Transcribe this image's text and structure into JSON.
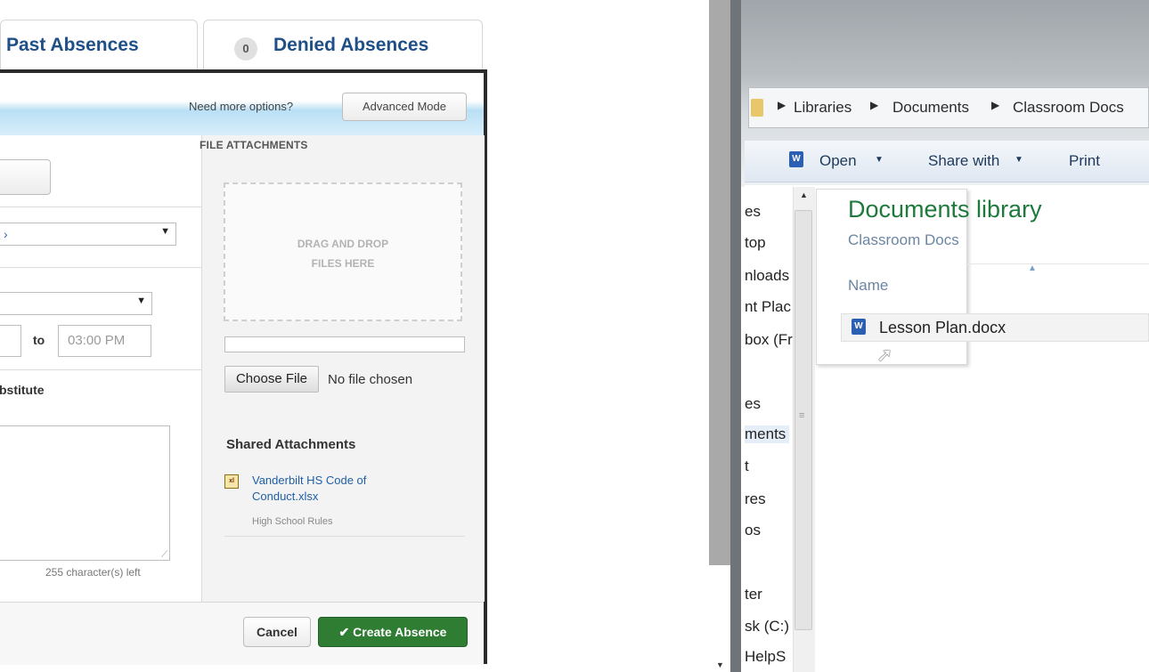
{
  "tabs": [
    {
      "label": "Past Absences"
    },
    {
      "badge": "0",
      "label": "Denied Absences"
    }
  ],
  "modal": {
    "options_prompt": "Need more options?",
    "advanced_mode_label": "Advanced Mode",
    "time_to_label": "to",
    "end_time_value": "03:00 PM",
    "substitute_label": "bstitute",
    "chars_left": "255 character(s) left",
    "file_attachments_heading": "FILE ATTACHMENTS",
    "dropzone_line1": "DRAG AND DROP",
    "dropzone_line2": "FILES HERE",
    "choose_file_label": "Choose File",
    "no_file_text": "No file chosen",
    "shared_attachments_heading": "Shared Attachments",
    "shared_attachment": {
      "line1": "Vanderbilt HS Code of",
      "line2": "Conduct.xlsx",
      "description": "High School Rules"
    },
    "cancel_label": "Cancel",
    "create_absence_label": "✔ Create Absence",
    "colors": {
      "accent_blue": "#1f4f87",
      "create_green": "#2e7d32"
    }
  },
  "explorer": {
    "breadcrumb": [
      "Libraries",
      "Documents",
      "Classroom Docs"
    ],
    "commands": {
      "open": "Open",
      "share": "Share with",
      "print": "Print"
    },
    "nav_items": [
      "es",
      "top",
      "nloads",
      "nt Plac",
      "box (Fr",
      "es",
      "ments",
      "t",
      "res",
      "os",
      "ter",
      "sk (C:)",
      "HelpS"
    ],
    "library_title": "Documents library",
    "library_subtitle": "Classroom Docs",
    "column_name": "Name",
    "file_name": "Lesson Plan.docx",
    "colors": {
      "title_green": "#1e7a3c"
    }
  }
}
